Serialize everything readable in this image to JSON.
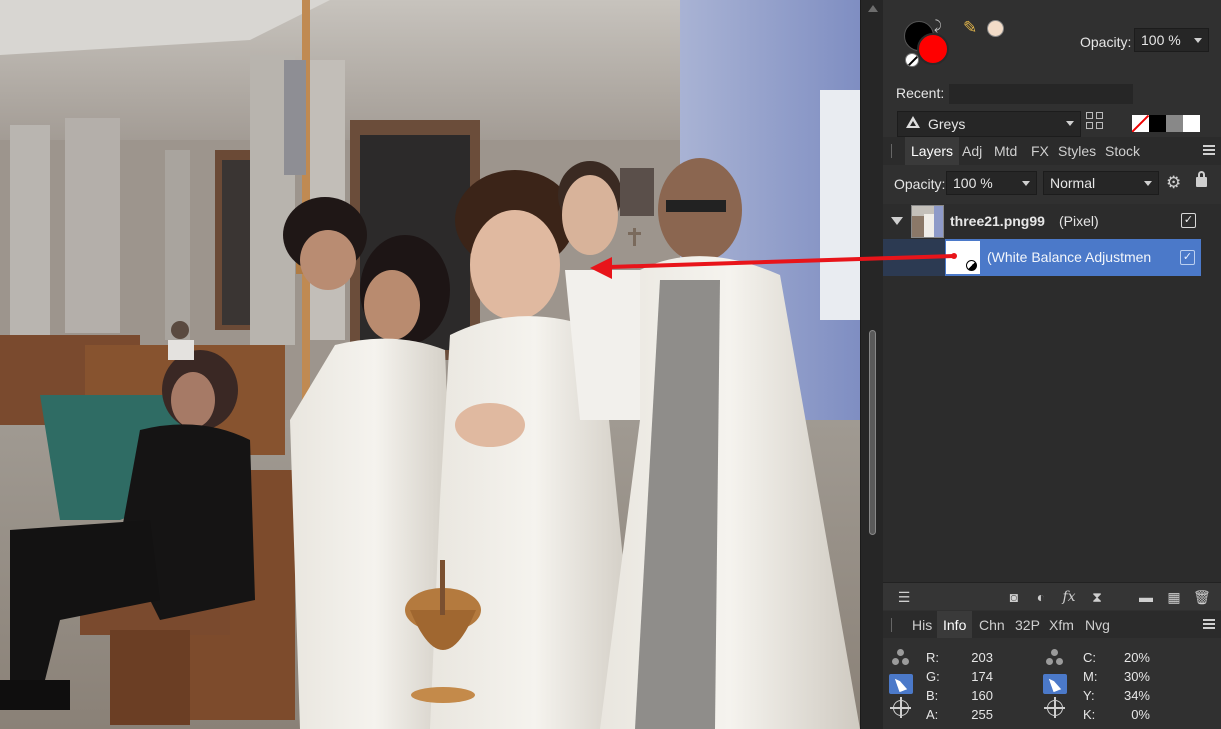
{
  "color_panel": {
    "opacity_label": "Opacity:",
    "opacity_value": "100 %",
    "recent_label": "Recent:",
    "palette_name": "Greys",
    "foreground_color": "#000000",
    "background_color": "#ff0000",
    "picked_color": "#f2dcc8"
  },
  "layers_tabs": [
    "Layers",
    "Adj",
    "Mtd",
    "FX",
    "Styles",
    "Stock"
  ],
  "layers_tabs_active": "Layers",
  "layers_controls": {
    "opacity_label": "Opacity:",
    "opacity_value": "100 %",
    "blend_mode": "Normal"
  },
  "layers": [
    {
      "name": "three21.png99",
      "type": "(Pixel)",
      "visible": true,
      "selected": false
    },
    {
      "name": "(White Balance Adjustmen",
      "visible": true,
      "selected": true
    }
  ],
  "info_tabs": [
    "His",
    "Info",
    "Chn",
    "32P",
    "Xfm",
    "Nvg"
  ],
  "info_tabs_active": "Info",
  "info": {
    "rgb": [
      {
        "label": "R:",
        "value": "203"
      },
      {
        "label": "G:",
        "value": "174"
      },
      {
        "label": "B:",
        "value": "160"
      },
      {
        "label": "A:",
        "value": "255"
      }
    ],
    "cmyk": [
      {
        "label": "C:",
        "value": "20%"
      },
      {
        "label": "M:",
        "value": "30%"
      },
      {
        "label": "Y:",
        "value": "34%"
      },
      {
        "label": "K:",
        "value": "0%"
      }
    ]
  },
  "colors": {
    "accent": "#4b79c9",
    "panel_bg": "#303030",
    "arrow": "#e8141a"
  }
}
